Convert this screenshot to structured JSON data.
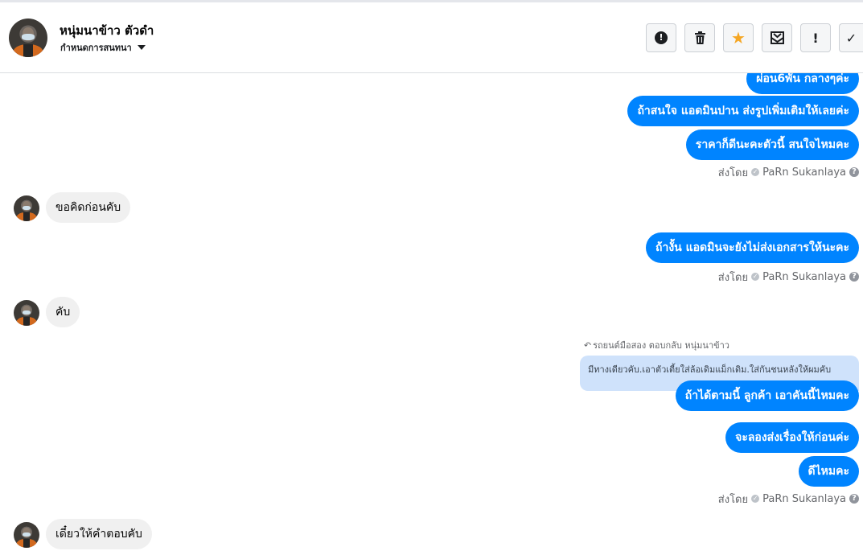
{
  "header": {
    "contact_name": "หนุ่มนาข้าว ตัวดำ",
    "subtitle": "กำหนดการสนทนา",
    "buttons": [
      {
        "icon": "exclamation-circle-icon",
        "glyph": "⬤"
      },
      {
        "icon": "trash-icon",
        "glyph": "🗑"
      },
      {
        "icon": "star-icon",
        "glyph": "★"
      },
      {
        "icon": "mark-unread-envelope-icon",
        "glyph": "✉"
      },
      {
        "icon": "exclamation-icon",
        "glyph": "!"
      },
      {
        "icon": "check-icon",
        "glyph": "✓"
      }
    ]
  },
  "colors": {
    "outgoing_bubble": "#0084ff",
    "incoming_bubble": "#f0f0f0",
    "quote_bubble": "#cfe2fb",
    "star": "#f5a623"
  },
  "messages": {
    "m1": "ผ่อน6พัน กลางๆค่ะ",
    "m2": "ถ้าสนใจ แอดมินปาน ส่งรูปเพิ่มเติมให้เลยค่ะ",
    "m3": "ราคาก็ดีนะคะตัวนี้ สนใจไหมคะ",
    "sent_by_1": "ส่งโดย",
    "sender_1": "PaRn Sukanlaya",
    "in1": "ขอคิดก่อนคับ",
    "m4": "ถ้างั้น แอดมินจะยังไม่ส่งเอกสารให้นะคะ",
    "sent_by_2": "ส่งโดย",
    "sender_2": "PaRn Sukanlaya",
    "in2": "คับ",
    "reply_label": "รถยนต์มือสอง ตอบกลับ หนุ่มนาข้าว",
    "quoted_text": "มีทางเดียวคับ.เอาตัวเตี้ยใส่ล้อเดิมแม็กเดิม.ใส่กันชนหลังให้ผมคับ",
    "m5": "ถ้าได้ตามนี้ ลูกค้า เอาคันนี้ไหมคะ",
    "m6": "จะลองส่งเรื่องให้ก่อนค่ะ",
    "m7": "ดีไหมคะ",
    "sent_by_3": "ส่งโดย",
    "sender_3": "PaRn Sukanlaya",
    "in3": "เดี๋ยวให้คำตอบคับ"
  }
}
